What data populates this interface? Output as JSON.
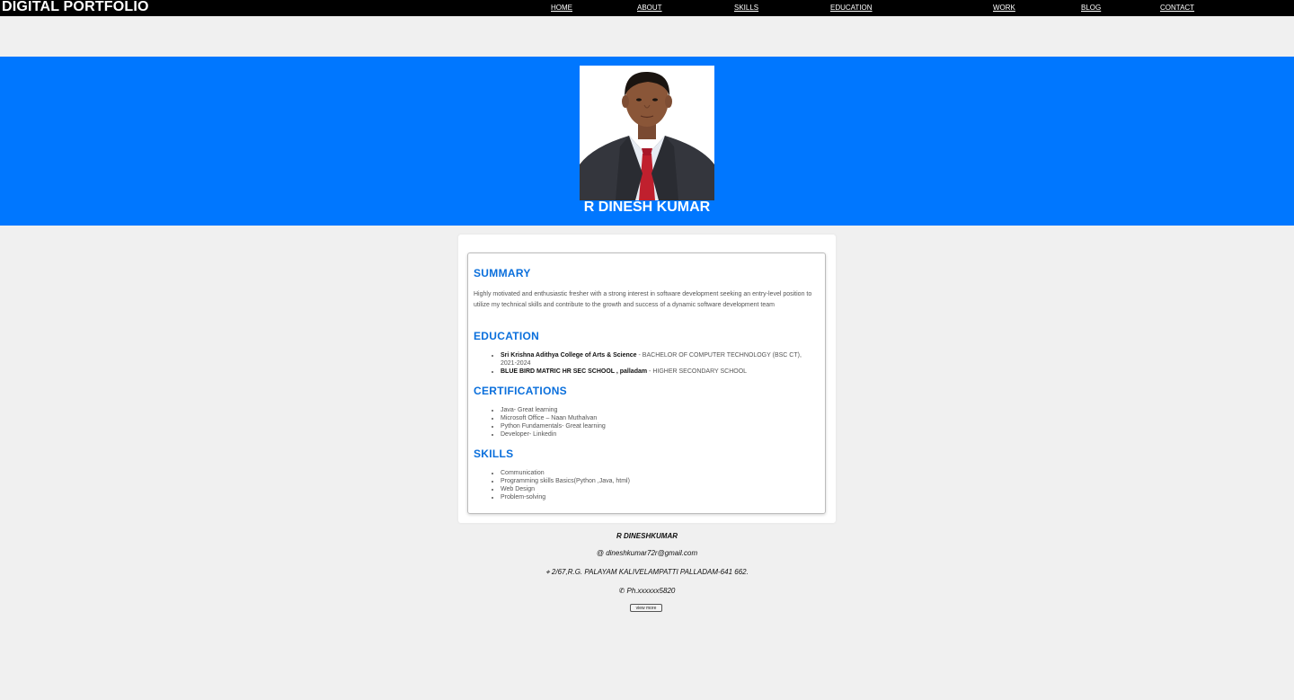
{
  "header": {
    "brand": "DIGITAL PORTFOLIO",
    "nav": [
      "HOME",
      "ABOUT",
      "SKILLS",
      "EDUCATION",
      "WORK",
      "BLOG",
      "CONTACT"
    ]
  },
  "hero": {
    "name": "R DINESH KUMAR",
    "background": "#0077ff"
  },
  "summary": {
    "title": "SUMMARY",
    "text": "Highly motivated and enthusiastic fresher with a strong interest in software development seeking an entry-level position to utilize my technical skills and contribute to the growth and success of a dynamic software development team"
  },
  "education": {
    "title": "EDUCATION",
    "items": [
      {
        "school": "Sri Krishna Adithya College of Arts & Science",
        "detail": " - BACHELOR OF COMPUTER TECHNOLOGY (BSC CT), 2021-2024"
      },
      {
        "school": "BLUE BIRD MATRIC HR SEC SCHOOL , palladam",
        "detail": " - HIGHER SECONDARY SCHOOL"
      }
    ]
  },
  "certifications": {
    "title": "CERTIFICATIONS",
    "items": [
      "Java- Great learning",
      "Microsoft Office – Naan Muthalvan",
      "Python Fundamentals- Great learning",
      "Developer- Linkedin"
    ]
  },
  "skills": {
    "title": "SKILLS",
    "items": [
      "Communication",
      "Programming skills Basics(Python ,Java, html)",
      "Web Design",
      "Problem-solving"
    ]
  },
  "footer": {
    "name": "R DINESHKUMAR",
    "email": "@ dineshkumar72r@gmail.com",
    "address": "⌖ 2/67,R.G. PALAYAM KALIVELAMPATTI PALLADAM-641 662.",
    "phone": "✆ Ph.xxxxxx5820",
    "button": "view more"
  },
  "accent": "#0a6fdc"
}
